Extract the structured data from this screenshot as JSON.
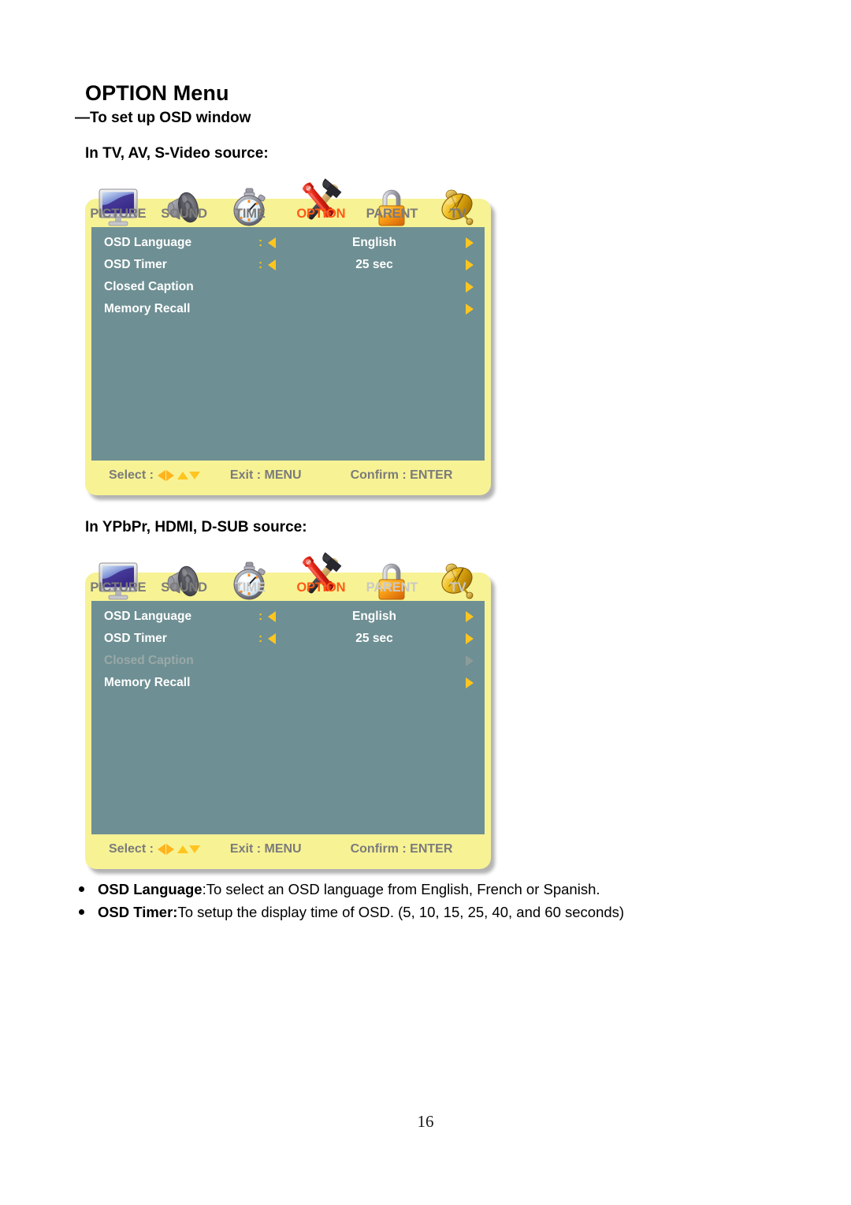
{
  "heading": {
    "title": "OPTION Menu",
    "subtitle": "—To set up OSD window"
  },
  "sections": [
    {
      "source_heading": "In TV, AV, S-Video source:",
      "tabs": [
        {
          "label": "PICTURE",
          "icon": "monitor-icon",
          "state": "normal"
        },
        {
          "label": "SOUND",
          "icon": "speaker-icon",
          "state": "normal"
        },
        {
          "label": "TIME",
          "icon": "stopwatch-icon",
          "state": "normal"
        },
        {
          "label": "OPTION",
          "icon": "tools-icon",
          "state": "active"
        },
        {
          "label": "PARENT",
          "icon": "padlock-icon",
          "state": "normal"
        },
        {
          "label": "TV",
          "icon": "satellite-dish-icon",
          "state": "normal"
        }
      ],
      "rows": [
        {
          "label": "OSD Language",
          "colon": ":",
          "value": "English",
          "has_left_arrow": true,
          "has_right_arrow": true,
          "state": "normal"
        },
        {
          "label": "OSD Timer",
          "colon": ":",
          "value": "25 sec",
          "has_left_arrow": true,
          "has_right_arrow": true,
          "state": "normal"
        },
        {
          "label": "Closed Caption",
          "colon": "",
          "value": "",
          "has_left_arrow": false,
          "has_right_arrow": true,
          "state": "normal"
        },
        {
          "label": "Memory Recall",
          "colon": "",
          "value": "",
          "has_left_arrow": false,
          "has_right_arrow": true,
          "state": "normal"
        }
      ],
      "hints": {
        "select": "Select :",
        "exit": "Exit : MENU",
        "confirm": "Confirm : ENTER"
      }
    },
    {
      "source_heading": "In YPbPr, HDMI, D-SUB source:",
      "tabs": [
        {
          "label": "PICTURE",
          "icon": "monitor-icon",
          "state": "normal"
        },
        {
          "label": "SOUND",
          "icon": "speaker-icon",
          "state": "normal"
        },
        {
          "label": "TIME",
          "icon": "stopwatch-icon",
          "state": "disabled"
        },
        {
          "label": "OPTION",
          "icon": "tools-icon",
          "state": "active"
        },
        {
          "label": "PARENT",
          "icon": "padlock-icon",
          "state": "disabled"
        },
        {
          "label": "TV",
          "icon": "satellite-dish-icon",
          "state": "disabled"
        }
      ],
      "rows": [
        {
          "label": "OSD Language",
          "colon": ":",
          "value": "English",
          "has_left_arrow": true,
          "has_right_arrow": true,
          "state": "normal"
        },
        {
          "label": "OSD Timer",
          "colon": ":",
          "value": "25 sec",
          "has_left_arrow": true,
          "has_right_arrow": true,
          "state": "normal"
        },
        {
          "label": "Closed Caption",
          "colon": "",
          "value": "",
          "has_left_arrow": false,
          "has_right_arrow": true,
          "state": "disabled"
        },
        {
          "label": "Memory Recall",
          "colon": "",
          "value": "",
          "has_left_arrow": false,
          "has_right_arrow": true,
          "state": "normal"
        }
      ],
      "hints": {
        "select": "Select :",
        "exit": "Exit : MENU",
        "confirm": "Confirm : ENTER"
      }
    }
  ],
  "bullets": [
    {
      "term": "OSD Language",
      "separator": ":",
      "text": " To select an OSD language from English, French or Spanish."
    },
    {
      "term": "OSD Timer:",
      "separator": "",
      "text": " To setup the display time of OSD. (5, 10, 15, 25, 40, and 60 seconds)"
    }
  ],
  "page_number": "16",
  "colors": {
    "panel_yellow": "#f7f294",
    "screen_teal": "#6e8f93",
    "tab_gray": "#7b7b7b",
    "tab_active_orange": "#ff5a14",
    "tab_disabled_gray": "#c9c9c9",
    "arrow_yellow": "#ffc51f",
    "row_text_white": "#ffffff",
    "row_disabled": "#9aa9a8"
  }
}
